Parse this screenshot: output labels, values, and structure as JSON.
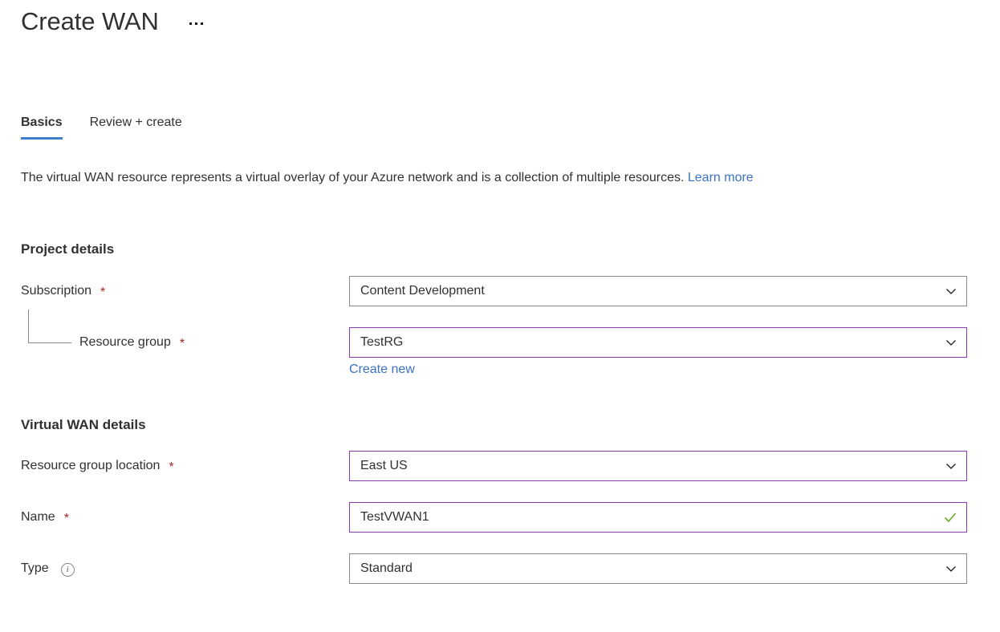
{
  "header": {
    "title": "Create WAN",
    "more_menu_label": "..."
  },
  "tabs": [
    {
      "label": "Basics",
      "active": true
    },
    {
      "label": "Review + create",
      "active": false
    }
  ],
  "description": {
    "text": "The virtual WAN resource represents a virtual overlay of your Azure network and is a collection of multiple resources. ",
    "link_label": "Learn more"
  },
  "sections": {
    "project_details": {
      "heading": "Project details",
      "fields": {
        "subscription": {
          "label": "Subscription",
          "required": "*",
          "value": "Content Development",
          "focused": false
        },
        "resource_group": {
          "label": "Resource group",
          "required": "*",
          "value": "TestRG",
          "focused": true,
          "create_new_label": "Create new"
        }
      }
    },
    "virtual_wan_details": {
      "heading": "Virtual WAN details",
      "fields": {
        "resource_group_location": {
          "label": "Resource group location",
          "required": "*",
          "value": "East US",
          "focused": true
        },
        "name": {
          "label": "Name",
          "required": "*",
          "value": "TestVWAN1",
          "focused": true,
          "validation": "valid"
        },
        "type": {
          "label": "Type",
          "info_tooltip": "i",
          "value": "Standard",
          "focused": false
        }
      }
    }
  },
  "colors": {
    "accent_blue": "#3f7fd0",
    "link_blue": "#3b72c4",
    "required_red": "#a4262c",
    "focus_purple": "#8a3ab0",
    "border_gray": "#8a8886",
    "valid_green": "#6aa823",
    "text": "#323130"
  },
  "icons": {
    "chevron_down": "chevron-down-icon",
    "checkmark": "checkmark-icon",
    "info": "info-icon",
    "more": "ellipsis-icon"
  }
}
